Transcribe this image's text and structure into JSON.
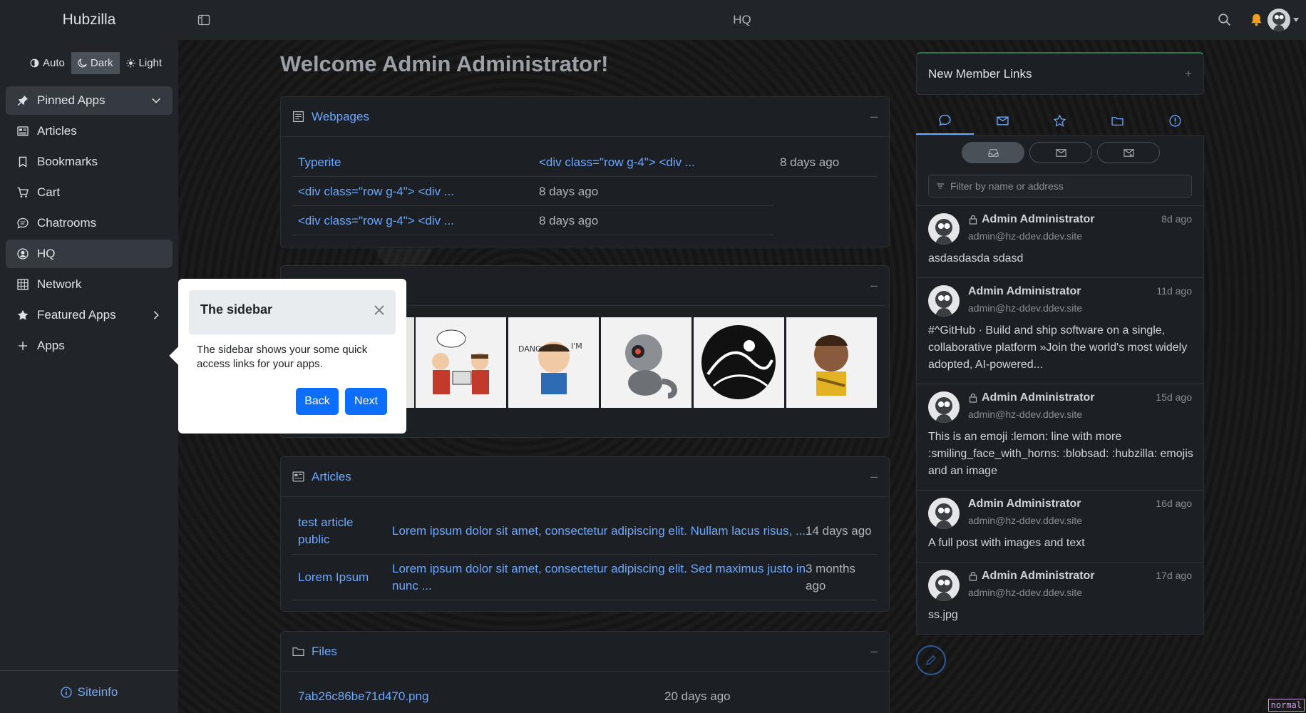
{
  "brand": "Hubzilla",
  "theme_switch": {
    "auto": "Auto",
    "dark": "Dark",
    "light": "Light",
    "selected": "Dark"
  },
  "nav": [
    {
      "label": "Pinned Apps",
      "icon": "pin-icon"
    },
    {
      "label": "Articles",
      "icon": "newspaper-icon"
    },
    {
      "label": "Bookmarks",
      "icon": "bookmark-icon"
    },
    {
      "label": "Cart",
      "icon": "cart-icon"
    },
    {
      "label": "Chatrooms",
      "icon": "chat-icon"
    },
    {
      "label": "HQ",
      "icon": "person-circle-icon"
    },
    {
      "label": "Network",
      "icon": "grid-icon"
    },
    {
      "label": "Featured Apps",
      "icon": "star-icon"
    },
    {
      "label": "Apps",
      "icon": "plus-icon"
    }
  ],
  "siteinfo": "Siteinfo",
  "topbar": {
    "title": "HQ"
  },
  "welcome": "Welcome Admin Administrator!",
  "webpages": {
    "title": "Webpages",
    "items": [
      {
        "name": "Typerite",
        "snippet": "<div class=\"row g-4\"> <div ...",
        "time": "8 days ago"
      },
      {
        "name": "<div class=\"row g-4\"> <div ...",
        "time": "8 days ago"
      },
      {
        "name": "<div class=\"row g-4\"> <div ...",
        "time": "8 days ago"
      }
    ]
  },
  "articles": {
    "title": "Articles",
    "items": [
      {
        "name_line1": "test article",
        "name_line2": "public",
        "summary": "Lorem ipsum dolor sit amet, consectetur adipiscing elit. Nullam lacus risus, ...",
        "time": "14 days ago"
      },
      {
        "name": "Lorem Ipsum",
        "summary_line1": "Lorem ipsum dolor sit amet, consectetur adipiscing elit. Sed maximus justo in",
        "summary_line2": "nunc ...",
        "time_line1": "3 months",
        "time_line2": "ago"
      }
    ]
  },
  "files": {
    "title": "Files",
    "items": [
      {
        "name": "7ab26c86be71d470.png",
        "time": "20 days ago"
      }
    ]
  },
  "new_member_links": "New Member Links",
  "filter": {
    "placeholder": "Filter by name or address"
  },
  "messages": [
    {
      "name": "Admin Administrator",
      "address": "admin@hz-ddev.ddev.site",
      "time": "8d ago",
      "text": "asdasdasda sdasd",
      "locked": true
    },
    {
      "name": "Admin Administrator",
      "address": "admin@hz-ddev.ddev.site",
      "time": "11d ago",
      "text": "#^GitHub · Build and ship software on a single, collaborative platform »Join the world's most widely adopted, AI-powered...",
      "locked": false
    },
    {
      "name": "Admin Administrator",
      "address": "admin@hz-ddev.ddev.site",
      "time": "15d ago",
      "text": "This is an emoji :lemon: line with more :smiling_face_with_horns: :blobsad: :hubzilla: emojis and an image",
      "locked": true
    },
    {
      "name": "Admin Administrator",
      "address": "admin@hz-ddev.ddev.site",
      "time": "16d ago",
      "text": "A full post with images and text",
      "locked": false
    },
    {
      "name": "Admin Administrator",
      "address": "admin@hz-ddev.ddev.site",
      "time": "17d ago",
      "text": "ss.jpg",
      "locked": true
    }
  ],
  "tour": {
    "title": "The sidebar",
    "body": "The sidebar shows your some quick access links for your apps.",
    "back": "Back",
    "next": "Next"
  },
  "mode_badge": "normal",
  "colors": {
    "accent": "#0d6efd",
    "link": "#6ea8fe",
    "sidebar_bg": "#212529"
  }
}
